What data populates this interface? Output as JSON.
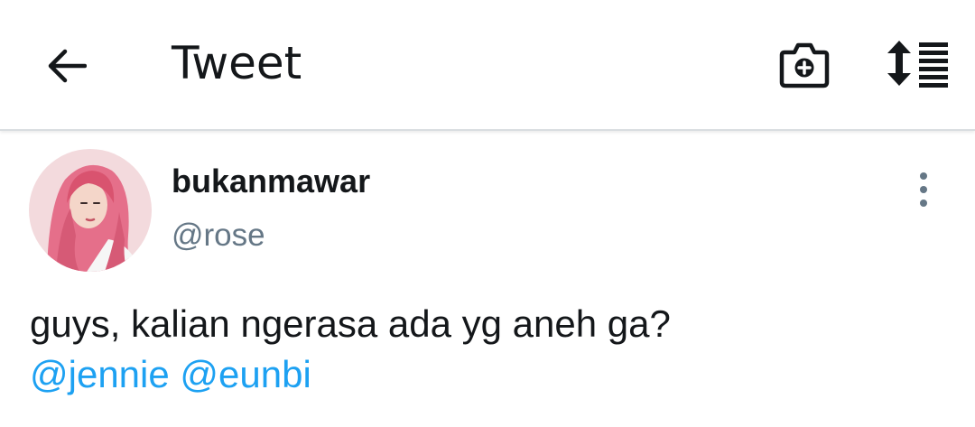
{
  "header": {
    "title": "Tweet",
    "back_icon": "arrow-left-icon",
    "camera_icon": "camera-plus-icon",
    "sort_icon": "sort-list-icon"
  },
  "tweet": {
    "display_name": "bukanmawar",
    "handle": "@rose",
    "text": "guys, kalian ngerasa ada yg aneh ga?",
    "mentions": [
      "@jennie",
      "@eunbi"
    ],
    "more_icon": "more-vertical-icon"
  },
  "colors": {
    "text": "#14171a",
    "secondary": "#657786",
    "link": "#1da1f2",
    "divider": "#d9dde0"
  }
}
